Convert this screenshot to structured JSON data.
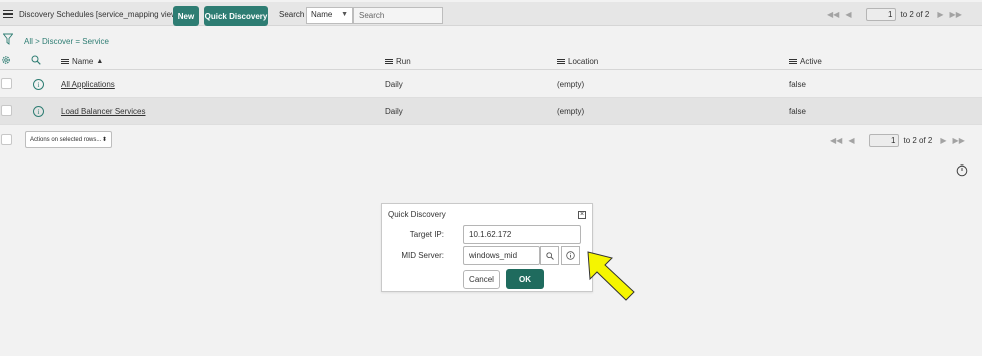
{
  "header": {
    "title": "Discovery Schedules [service_mapping view]",
    "new_label": "New",
    "quick_discovery_label": "Quick Discovery",
    "search_label": "Search",
    "search_field": "Name",
    "search_placeholder": "Search",
    "pager": {
      "current_page": "1",
      "range_text": "to 2 of 2"
    }
  },
  "breadcrumb": "All > Discover = Service",
  "table": {
    "columns": [
      "Name",
      "Run",
      "Location",
      "Active"
    ],
    "sort": {
      "column": "Name",
      "direction": "ascending"
    },
    "rows": [
      {
        "name": "All Applications",
        "run": "Daily",
        "location": "(empty)",
        "active": "false"
      },
      {
        "name": "Load Balancer Services",
        "run": "Daily",
        "location": "(empty)",
        "active": "false"
      }
    ]
  },
  "footer": {
    "actions_label": "Actions on selected rows...",
    "pager": {
      "current_page": "1",
      "range_text": "to 2 of 2"
    }
  },
  "dialog": {
    "title": "Quick Discovery",
    "target_ip_label": "Target IP:",
    "target_ip_value": "10.1.62.172",
    "mid_server_label": "MID Server:",
    "mid_server_value": "windows_mid",
    "cancel_label": "Cancel",
    "ok_label": "OK"
  },
  "colors": {
    "accent": "#2e7d73",
    "ok_button": "#1f6b5e",
    "arrow_fill": "#f5f500",
    "background": "#f2f2f2"
  },
  "icons": [
    "hamburger-icon",
    "filter-icon",
    "gear-icon",
    "search-icon",
    "info-icon",
    "close-icon",
    "timer-icon",
    "pointer-arrow"
  ]
}
